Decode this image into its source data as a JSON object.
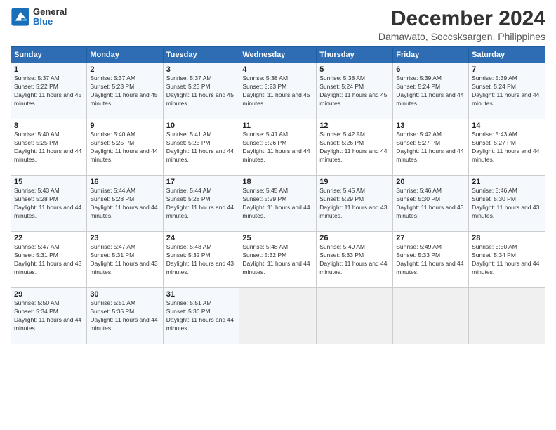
{
  "header": {
    "logo": {
      "general": "General",
      "blue": "Blue"
    },
    "title": "December 2024",
    "subtitle": "Damawato, Soccsksargen, Philippines"
  },
  "calendar": {
    "days_of_week": [
      "Sunday",
      "Monday",
      "Tuesday",
      "Wednesday",
      "Thursday",
      "Friday",
      "Saturday"
    ],
    "weeks": [
      [
        {
          "day": "",
          "empty": true
        },
        {
          "day": "",
          "empty": true
        },
        {
          "day": "",
          "empty": true
        },
        {
          "day": "",
          "empty": true
        },
        {
          "day": "",
          "empty": true
        },
        {
          "day": "",
          "empty": true
        },
        {
          "day": "",
          "empty": true
        }
      ],
      [
        {
          "day": "1",
          "sunrise": "5:37 AM",
          "sunset": "5:22 PM",
          "daylight": "11 hours and 45 minutes."
        },
        {
          "day": "2",
          "sunrise": "5:37 AM",
          "sunset": "5:23 PM",
          "daylight": "11 hours and 45 minutes."
        },
        {
          "day": "3",
          "sunrise": "5:37 AM",
          "sunset": "5:23 PM",
          "daylight": "11 hours and 45 minutes."
        },
        {
          "day": "4",
          "sunrise": "5:38 AM",
          "sunset": "5:23 PM",
          "daylight": "11 hours and 45 minutes."
        },
        {
          "day": "5",
          "sunrise": "5:38 AM",
          "sunset": "5:24 PM",
          "daylight": "11 hours and 45 minutes."
        },
        {
          "day": "6",
          "sunrise": "5:39 AM",
          "sunset": "5:24 PM",
          "daylight": "11 hours and 44 minutes."
        },
        {
          "day": "7",
          "sunrise": "5:39 AM",
          "sunset": "5:24 PM",
          "daylight": "11 hours and 44 minutes."
        }
      ],
      [
        {
          "day": "8",
          "sunrise": "5:40 AM",
          "sunset": "5:25 PM",
          "daylight": "11 hours and 44 minutes."
        },
        {
          "day": "9",
          "sunrise": "5:40 AM",
          "sunset": "5:25 PM",
          "daylight": "11 hours and 44 minutes."
        },
        {
          "day": "10",
          "sunrise": "5:41 AM",
          "sunset": "5:25 PM",
          "daylight": "11 hours and 44 minutes."
        },
        {
          "day": "11",
          "sunrise": "5:41 AM",
          "sunset": "5:26 PM",
          "daylight": "11 hours and 44 minutes."
        },
        {
          "day": "12",
          "sunrise": "5:42 AM",
          "sunset": "5:26 PM",
          "daylight": "11 hours and 44 minutes."
        },
        {
          "day": "13",
          "sunrise": "5:42 AM",
          "sunset": "5:27 PM",
          "daylight": "11 hours and 44 minutes."
        },
        {
          "day": "14",
          "sunrise": "5:43 AM",
          "sunset": "5:27 PM",
          "daylight": "11 hours and 44 minutes."
        }
      ],
      [
        {
          "day": "15",
          "sunrise": "5:43 AM",
          "sunset": "5:28 PM",
          "daylight": "11 hours and 44 minutes."
        },
        {
          "day": "16",
          "sunrise": "5:44 AM",
          "sunset": "5:28 PM",
          "daylight": "11 hours and 44 minutes."
        },
        {
          "day": "17",
          "sunrise": "5:44 AM",
          "sunset": "5:28 PM",
          "daylight": "11 hours and 44 minutes."
        },
        {
          "day": "18",
          "sunrise": "5:45 AM",
          "sunset": "5:29 PM",
          "daylight": "11 hours and 44 minutes."
        },
        {
          "day": "19",
          "sunrise": "5:45 AM",
          "sunset": "5:29 PM",
          "daylight": "11 hours and 43 minutes."
        },
        {
          "day": "20",
          "sunrise": "5:46 AM",
          "sunset": "5:30 PM",
          "daylight": "11 hours and 43 minutes."
        },
        {
          "day": "21",
          "sunrise": "5:46 AM",
          "sunset": "5:30 PM",
          "daylight": "11 hours and 43 minutes."
        }
      ],
      [
        {
          "day": "22",
          "sunrise": "5:47 AM",
          "sunset": "5:31 PM",
          "daylight": "11 hours and 43 minutes."
        },
        {
          "day": "23",
          "sunrise": "5:47 AM",
          "sunset": "5:31 PM",
          "daylight": "11 hours and 43 minutes."
        },
        {
          "day": "24",
          "sunrise": "5:48 AM",
          "sunset": "5:32 PM",
          "daylight": "11 hours and 43 minutes."
        },
        {
          "day": "25",
          "sunrise": "5:48 AM",
          "sunset": "5:32 PM",
          "daylight": "11 hours and 44 minutes."
        },
        {
          "day": "26",
          "sunrise": "5:49 AM",
          "sunset": "5:33 PM",
          "daylight": "11 hours and 44 minutes."
        },
        {
          "day": "27",
          "sunrise": "5:49 AM",
          "sunset": "5:33 PM",
          "daylight": "11 hours and 44 minutes."
        },
        {
          "day": "28",
          "sunrise": "5:50 AM",
          "sunset": "5:34 PM",
          "daylight": "11 hours and 44 minutes."
        }
      ],
      [
        {
          "day": "29",
          "sunrise": "5:50 AM",
          "sunset": "5:34 PM",
          "daylight": "11 hours and 44 minutes."
        },
        {
          "day": "30",
          "sunrise": "5:51 AM",
          "sunset": "5:35 PM",
          "daylight": "11 hours and 44 minutes."
        },
        {
          "day": "31",
          "sunrise": "5:51 AM",
          "sunset": "5:36 PM",
          "daylight": "11 hours and 44 minutes."
        },
        {
          "day": "",
          "empty": true
        },
        {
          "day": "",
          "empty": true
        },
        {
          "day": "",
          "empty": true
        },
        {
          "day": "",
          "empty": true
        }
      ]
    ]
  }
}
